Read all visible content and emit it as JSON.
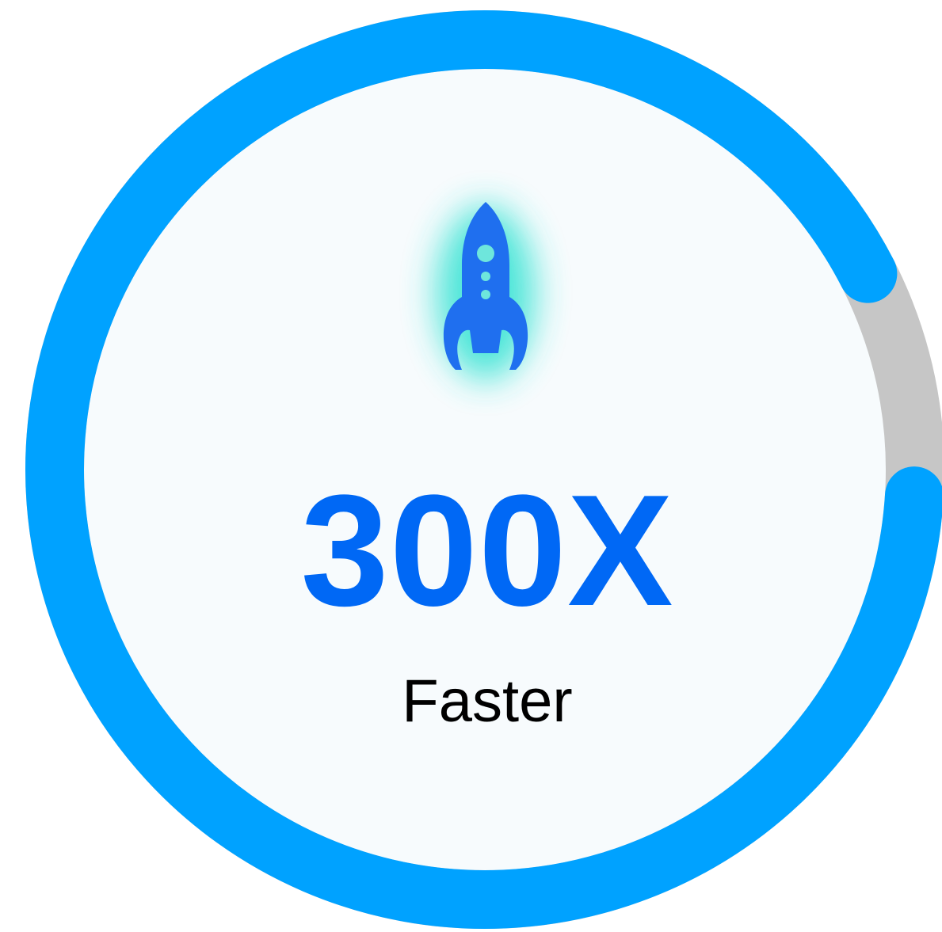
{
  "metric": {
    "value": "300X",
    "label": "Faster",
    "progress_fraction": 0.915
  },
  "icon": {
    "name": "rocket-icon"
  },
  "colors": {
    "ring_progress": "#00a2ff",
    "ring_track": "#c6c6c6",
    "value_text": "#0068f5",
    "label_text": "#000000",
    "rocket": "#1f6fef",
    "rocket_windows": "#6ee6dc",
    "rocket_glow": "#2fe2d2",
    "card_fill": "#f7fbfd"
  }
}
